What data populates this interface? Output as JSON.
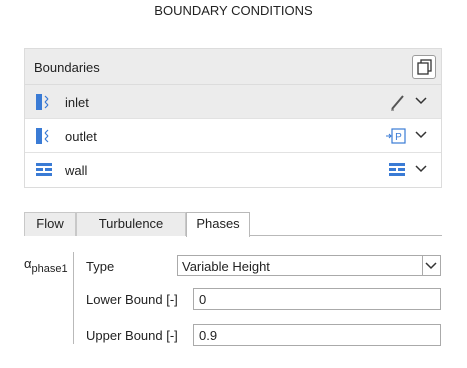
{
  "title": "BOUNDARY CONDITIONS",
  "boundaries": {
    "header": "Boundaries",
    "copy_icon": "copy-icon",
    "rows": [
      {
        "name": "inlet",
        "icon": "inlet-icon",
        "action_icon": "pencil-icon",
        "selected": true
      },
      {
        "name": "outlet",
        "icon": "outlet-icon",
        "action_icon": "pressure-outlet-icon",
        "action_text": "P",
        "selected": false
      },
      {
        "name": "wall",
        "icon": "wall-icon",
        "action_icon": "wall-type-icon",
        "selected": false
      }
    ]
  },
  "tabs": [
    {
      "label": "Flow",
      "active": false
    },
    {
      "label": "Turbulence",
      "active": false
    },
    {
      "label": "Phases",
      "active": true
    }
  ],
  "phase": {
    "symbol": "α",
    "subscript": "phase1",
    "type_label": "Type",
    "type_value": "Variable Height",
    "lower_label": "Lower Bound [-]",
    "lower_value": "0",
    "upper_label": "Upper Bound [-]",
    "upper_value": "0.9"
  },
  "colors": {
    "accent_blue": "#3a7bd5",
    "selected_row": "#ececec"
  }
}
